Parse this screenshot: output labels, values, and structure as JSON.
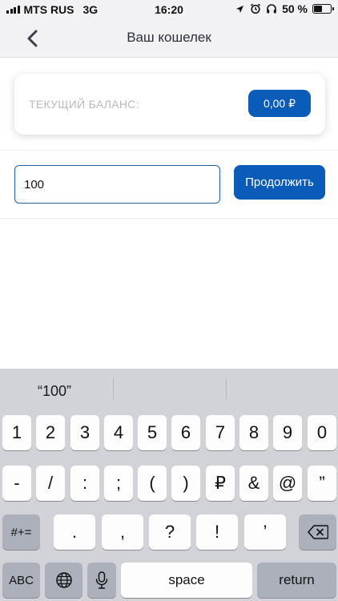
{
  "status_bar": {
    "carrier": "MTS RUS",
    "network": "3G",
    "time": "16:20",
    "battery": "50 %",
    "battery_level": 0.5
  },
  "nav": {
    "title": "Ваш кошелек"
  },
  "balance": {
    "label": "ТЕКУЩИЙ БАЛАНС:",
    "value": "0,00 ₽"
  },
  "amount": {
    "value": "100"
  },
  "continue_label": "Продолжить",
  "keyboard": {
    "suggestions": [
      "“100”",
      "",
      ""
    ],
    "row1": [
      "1",
      "2",
      "3",
      "4",
      "5",
      "6",
      "7",
      "8",
      "9",
      "0"
    ],
    "row2": [
      "-",
      "/",
      ":",
      ";",
      "(",
      ")",
      "₽",
      "&",
      "@",
      "”"
    ],
    "row3": [
      ".",
      ",",
      "?",
      "!",
      "’"
    ],
    "symbols_label": "#+=",
    "abc_label": "ABC",
    "space_label": "space",
    "return_label": "return"
  },
  "colors": {
    "accent": "#0b5cb8",
    "input_border": "#1e63a9",
    "muted_label": "#b7b9bf",
    "keyboard_bg": "#d1d3d9"
  }
}
